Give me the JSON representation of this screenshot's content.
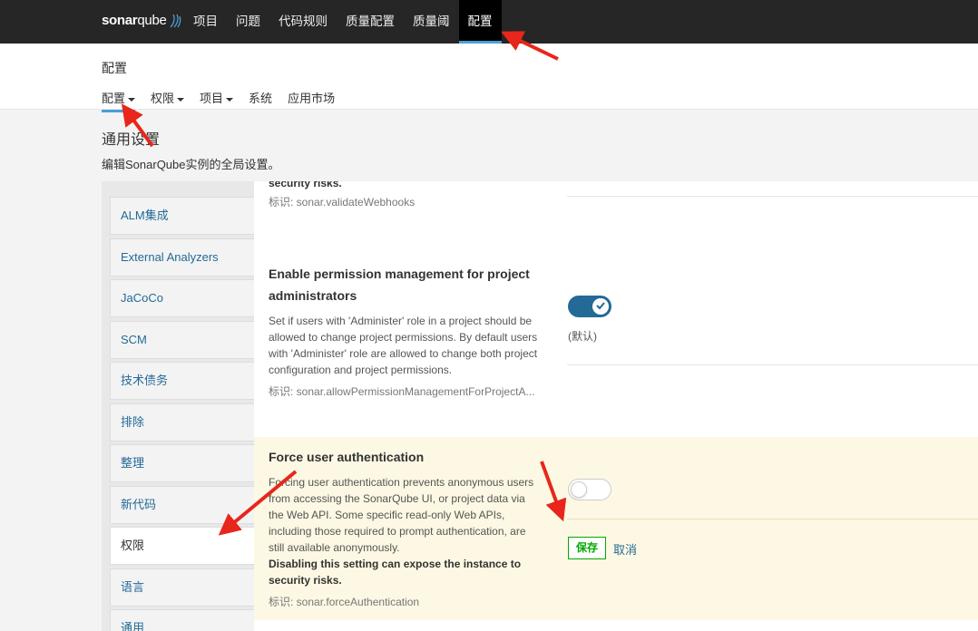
{
  "brand": {
    "sonar": "sonar",
    "qube": "qube"
  },
  "topnav": [
    "项目",
    "问题",
    "代码规则",
    "质量配置",
    "质量阈",
    "配置"
  ],
  "page_title": "配置",
  "subnav": [
    "配置",
    "权限",
    "项目",
    "系统",
    "应用市场"
  ],
  "section": {
    "title": "通用设置",
    "description": "编辑SonarQube实例的全局设置。"
  },
  "categories": [
    "ALM集成",
    "External Analyzers",
    "JaCoCo",
    "SCM",
    "技术债务",
    "排除",
    "整理",
    "新代码",
    "权限",
    "语言",
    "通用"
  ],
  "prev_setting": {
    "tail": "security risks.",
    "key": "标识: sonar.validateWebhooks"
  },
  "setting_permission": {
    "title_line1": "Enable permission management for project",
    "title_line2": "administrators",
    "desc1": "Set if users with 'Administer' role in a project should be",
    "desc2": "allowed to change project permissions. By default users",
    "desc3": "with 'Administer' role are allowed to change both project",
    "desc4": "configuration and project permissions.",
    "key": "标识: sonar.allowPermissionManagementForProjectA...",
    "default_note": "(默认)",
    "toggle_on": true
  },
  "setting_force_auth": {
    "title": "Force user authentication",
    "desc1": "Forcing user authentication prevents anonymous users",
    "desc2": "from accessing the SonarQube UI, or project data via",
    "desc3": "the Web API. Some specific read-only Web APIs,",
    "desc4": "including those required to prompt authentication, are",
    "desc5": "still available anonymously.",
    "warn1": "Disabling this setting can expose the instance to",
    "warn2": "security risks.",
    "key": "标识: sonar.forceAuthentication",
    "toggle_on": false,
    "save": "保存",
    "cancel": "取消"
  },
  "colors": {
    "nav_bg": "#262626",
    "accent": "#4b9fd5",
    "link": "#236a97",
    "highlight_bg": "#fcf8e3",
    "save_green": "#00aa00",
    "arrow_red": "#e8261b"
  }
}
